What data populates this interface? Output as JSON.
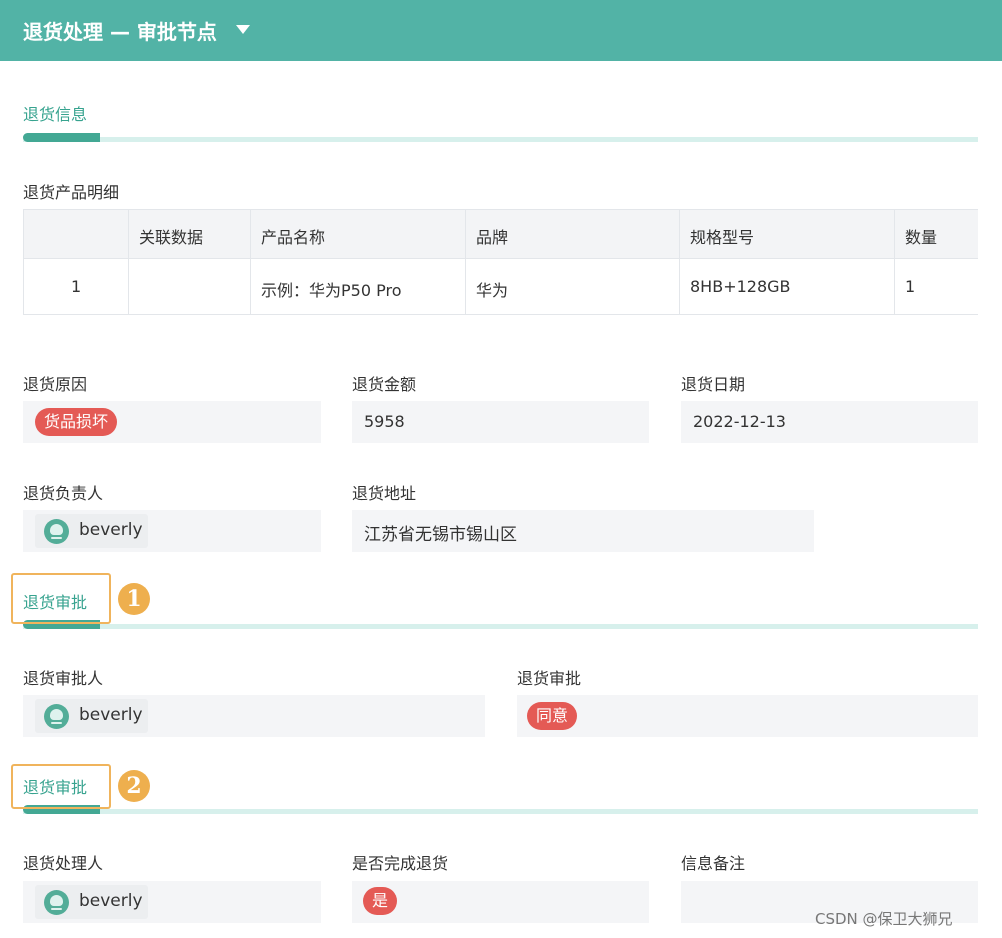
{
  "header": {
    "title": "退货处理 — 审批节点",
    "caret": "caret-down-icon"
  },
  "section_info": {
    "title": "退货信息",
    "table_caption": "退货产品明细",
    "columns": [
      "",
      "关联数据",
      "产品名称",
      "品牌",
      "规格型号",
      "数量"
    ],
    "rows": [
      [
        "1",
        "",
        "示例：华为P50 Pro",
        "华为",
        "8HB+128GB",
        "1"
      ]
    ],
    "fields": {
      "reason_label": "退货原因",
      "reason_value": "货品损坏",
      "amount_label": "退货金额",
      "amount_value": "5958",
      "date_label": "退货日期",
      "date_value": "2022-12-13",
      "owner_label": "退货负责人",
      "owner_value": "beverly",
      "address_label": "退货地址",
      "address_value": "江苏省无锡市锡山区"
    }
  },
  "section_approval": {
    "title": "退货审批",
    "callout": "1",
    "approver_label": "退货审批人",
    "approver_value": "beverly",
    "approval_label": "退货审批",
    "approval_value": "同意"
  },
  "section_process": {
    "title": "退货审批",
    "callout": "2",
    "handler_label": "退货处理人",
    "handler_value": "beverly",
    "done_label": "是否完成退货",
    "done_value": "是",
    "note_label": "信息备注",
    "note_value": ""
  },
  "watermark": "CSDN @保卫大狮兄",
  "colors": {
    "header": "#52b3a6",
    "accent": "#43a894",
    "tag_red": "#e45a55",
    "callout": "#eeaf4e"
  }
}
